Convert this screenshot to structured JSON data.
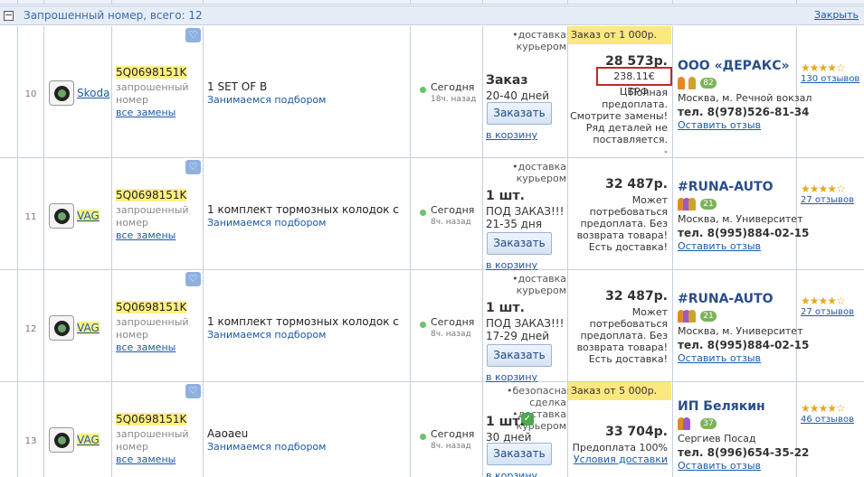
{
  "group": {
    "title": "Запрошенный номер, всего: 12",
    "close": "Закрыть",
    "toggle": "−"
  },
  "colors": {
    "highlight": "#fff080",
    "link": "#1a5aa8",
    "promo": "#fde77f",
    "border_alert": "#c0282a"
  },
  "rows": [
    {
      "num": "10",
      "brand": "Skoda",
      "brand_highlight": false,
      "article": "5Q0698151K",
      "article_sub1": "запрошенный",
      "article_sub2": "номер",
      "replacements": "все замены",
      "desc": "1 SET OF B",
      "desc_sub": "Занимаемся подбором",
      "date": "Сегодня",
      "date_ago": "18ч. назад",
      "delivery": [
        "•доставка",
        "курьером"
      ],
      "qty": "Заказ",
      "qty_sub": [
        "20-40 дней"
      ],
      "order_btn": "Заказать",
      "cart": "в корзину",
      "promo": "Заказ от 1 000р.",
      "price": "28 573р.",
      "price_euro": "238.11€ ЦБРФ",
      "note": [
        "Полная",
        "предоплата.",
        "Смотрите замены!",
        "Ряд деталей не",
        "поставляется.",
        "-"
      ],
      "seller": "ООО «ДЕРАКС»",
      "badge": "82",
      "city": "Москва, м. Речной вокзал",
      "phone": "тел. 8(978)526-81-34",
      "leave_review": "Оставить отзыв",
      "stars": "★★★★☆",
      "reviews": "130 отзывов"
    },
    {
      "num": "11",
      "brand": "VAG",
      "brand_highlight": true,
      "article": "5Q0698151K",
      "article_sub1": "запрошенный",
      "article_sub2": "номер",
      "replacements": "все замены",
      "desc": "1 комплект тормозных колодок с",
      "desc_sub": "Занимаемся подбором",
      "date": "Сегодня",
      "date_ago": "8ч. назад",
      "delivery": [
        "•доставка",
        "курьером"
      ],
      "qty": "1 шт.",
      "qty_sub": [
        "ПОД ЗАКАЗ!!!",
        "21-35 дня"
      ],
      "order_btn": "Заказать",
      "cart": "в корзину",
      "price": "32 487р.",
      "note": [
        "Может",
        "потребоваться",
        "предоплата. Без",
        "возврата товара!",
        "Есть доставка!"
      ],
      "seller": "#RUNA-AUTO",
      "badge": "21",
      "city": "Москва, м. Университет",
      "phone": "тел. 8(995)884-02-15",
      "leave_review": "Оставить отзыв",
      "stars": "★★★★☆",
      "reviews": "27 отзывов"
    },
    {
      "num": "12",
      "brand": "VAG",
      "brand_highlight": true,
      "article": "5Q0698151K",
      "article_sub1": "запрошенный",
      "article_sub2": "номер",
      "replacements": "все замены",
      "desc": "1 комплект тормозных колодок с",
      "desc_sub": "Занимаемся подбором",
      "date": "Сегодня",
      "date_ago": "8ч. назад",
      "delivery": [
        "•доставка",
        "курьером"
      ],
      "qty": "1 шт.",
      "qty_sub": [
        "ПОД ЗАКАЗ!!!",
        "17-29 дней"
      ],
      "order_btn": "Заказать",
      "cart": "в корзину",
      "price": "32 487р.",
      "note": [
        "Может",
        "потребоваться",
        "предоплата. Без",
        "возврата товара!",
        "Есть доставка!"
      ],
      "seller": "#RUNA-AUTO",
      "badge": "21",
      "city": "Москва, м. Университет",
      "phone": "тел. 8(995)884-02-15",
      "leave_review": "Оставить отзыв",
      "stars": "★★★★☆",
      "reviews": "27 отзывов"
    },
    {
      "num": "13",
      "brand": "VAG",
      "brand_highlight": true,
      "article": "5Q0698151K",
      "article_sub1": "запрошенный",
      "article_sub2": "номер",
      "replacements": "все замены",
      "desc": "Ааоаеu",
      "desc_sub": "Занимаемся подбором",
      "date": "Сегодня",
      "date_ago": "8ч. назад",
      "delivery": [
        "•безопасная",
        "сделка",
        "•доставка",
        "курьером"
      ],
      "qty": "1 шт.",
      "qty_sub": [
        "30 дней"
      ],
      "order_btn": "Заказать",
      "cart": "в корзину",
      "promo": "Заказ от 5 000р.",
      "price": "33 704р.",
      "note": [
        "Предоплата 100%"
      ],
      "note_link": "Условия доставки",
      "seller": "ИП Белякин",
      "badge": "37",
      "city": "Сергиев Посад",
      "phone": "тел. 8(996)654-35-22",
      "leave_review": "Оставить отзыв",
      "stars": "★★★★☆",
      "reviews": "46 отзывов"
    }
  ]
}
